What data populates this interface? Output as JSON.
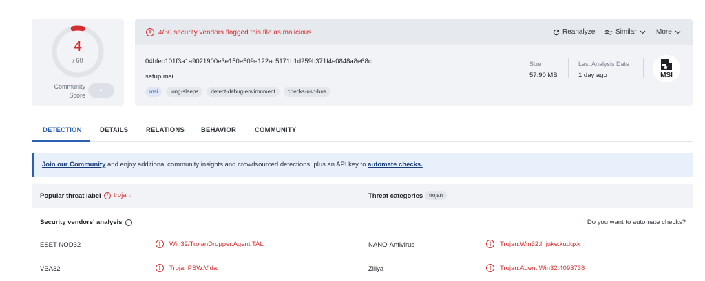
{
  "score": {
    "value": "4",
    "total": "/ 60",
    "community_label": "Community Score",
    "detection_fraction": 0.0667,
    "colors": {
      "malicious": "#d32f2f",
      "ring": "#e1e4e9"
    }
  },
  "alert": {
    "text": "4/60 security vendors flagged this file as malicious"
  },
  "actions": {
    "reanalyze": "Reanalyze",
    "similar": "Similar",
    "more": "More"
  },
  "file": {
    "hash": "04bfec101f3a1a9021900e3e150e509e122ac5171b1d259b371f4e0848a8e68c",
    "name": "setup.msi",
    "tags": [
      "msi",
      "long-sleeps",
      "detect-debug-environment",
      "checks-usb-bus"
    ],
    "size_label": "Size",
    "size_value": "57.90 MB",
    "date_label": "Last Analysis Date",
    "date_value": "1 day ago",
    "type_badge": "MSI"
  },
  "tabs": [
    "DETECTION",
    "DETAILS",
    "RELATIONS",
    "BEHAVIOR",
    "COMMUNITY"
  ],
  "banner": {
    "link1": "Join our Community",
    "middle": " and enjoy additional community insights and crowdsourced detections, plus an API key to ",
    "link2": "automate checks."
  },
  "threat": {
    "popular_label": "Popular threat label",
    "popular_value": "trojan.",
    "categories_label": "Threat categories",
    "categories_value": "trojan"
  },
  "vendors": {
    "title": "Security vendors' analysis",
    "automate": "Do you want to automate checks?",
    "rows": [
      {
        "v1": "ESET-NOD32",
        "d1": "Win32/TrojanDropper.Agent.TAL",
        "v2": "NANO-Antivirus",
        "d2": "Trojan.Win32.Injuke.kudqxk"
      },
      {
        "v1": "VBA32",
        "d1": "TrojanPSW.Vidar",
        "v2": "Zillya",
        "d2": "Trojan.Agent.Win32.4093738"
      }
    ]
  }
}
